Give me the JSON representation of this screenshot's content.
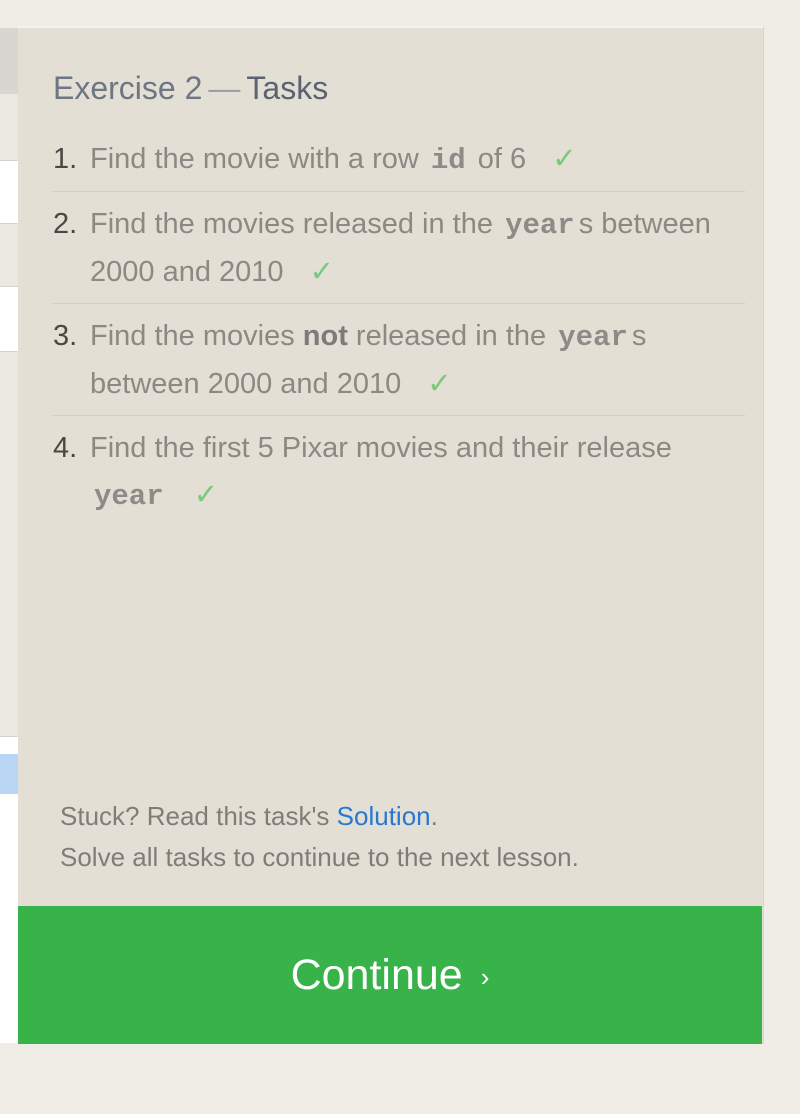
{
  "panel": {
    "title_exercise": "Exercise 2",
    "title_separator": "—",
    "title_tasks": "Tasks"
  },
  "tasks": [
    {
      "number": "1.",
      "text_before": "Find the movie with a row",
      "keyword": "id",
      "text_after": "of 6",
      "check": "✓"
    },
    {
      "number": "2.",
      "text_before": "Find the movies released in the",
      "keyword": "year",
      "text_after": "s between 2000 and 2010",
      "check": "✓"
    },
    {
      "number": "3.",
      "text_before": "Find the movies",
      "bold": "not",
      "text_middle": "released in the",
      "keyword": "year",
      "text_after": "s between 2000 and 2010",
      "check": "✓"
    },
    {
      "number": "4.",
      "text_before": "Find the first 5 Pixar movies and their release",
      "keyword": "year",
      "check": "✓"
    }
  ],
  "help": {
    "stuck_prefix": "Stuck? Read this task's",
    "solution_link": "Solution",
    "stuck_suffix": ".",
    "continue_note": "Solve all tasks to continue to the next lesson."
  },
  "continue_button": {
    "label": "Continue",
    "arrow": "›"
  },
  "colors": {
    "panel_bg": "#e3dfd5",
    "button_green": "#37b34a",
    "check_green": "#79c97c",
    "link_blue": "#2878d0"
  },
  "icons": {
    "check": "check-icon",
    "arrow": "chevron-right-icon"
  }
}
